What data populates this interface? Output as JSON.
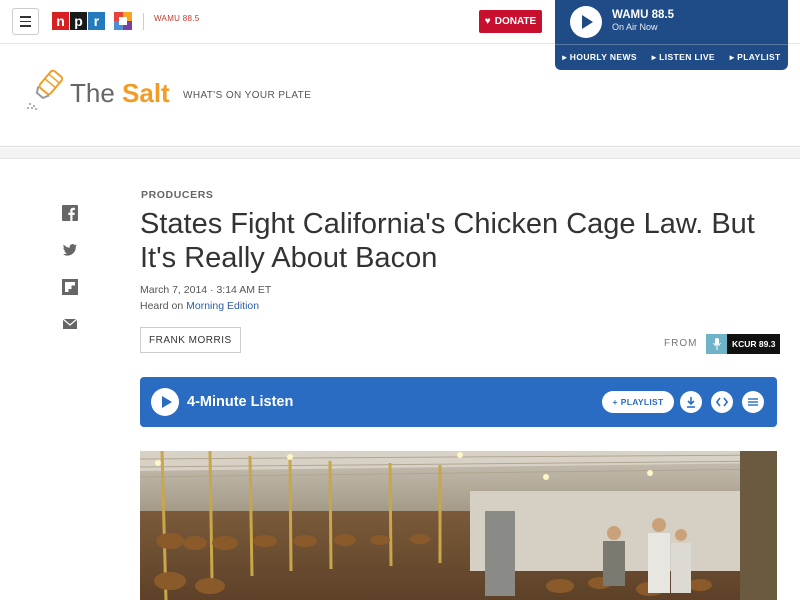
{
  "topbar": {
    "logo_letters": [
      "n",
      "p",
      "r"
    ],
    "station_logo_text": "WAMU",
    "station_logo_freq": "88.5",
    "donate_label": "DONATE"
  },
  "player": {
    "station": "WAMU 88.5",
    "status": "On Air Now",
    "links": [
      "HOURLY NEWS",
      "LISTEN LIVE",
      "PLAYLIST"
    ]
  },
  "blog": {
    "the": "The ",
    "salt": "Salt",
    "tagline": "WHAT'S ON YOUR PLATE"
  },
  "article": {
    "slug": "PRODUCERS",
    "headline": "States Fight California's Chicken Cage Law. But It's Really About Bacon",
    "date": "March 7, 2014 · 3:14 AM ET",
    "heard_on_prefix": "Heard on ",
    "heard_on_show": "Morning Edition",
    "byline": "FRANK MORRIS",
    "from_label": "FROM",
    "station": "KCUR 89.3"
  },
  "audio": {
    "title": "4-Minute Listen",
    "playlist_label": "PLAYLIST"
  },
  "colors": {
    "npr_red": "#d62021",
    "player_blue": "#1f4c86",
    "audio_blue": "#2a6cc1",
    "salt_orange": "#f39c25",
    "donate_red": "#c8102e"
  }
}
